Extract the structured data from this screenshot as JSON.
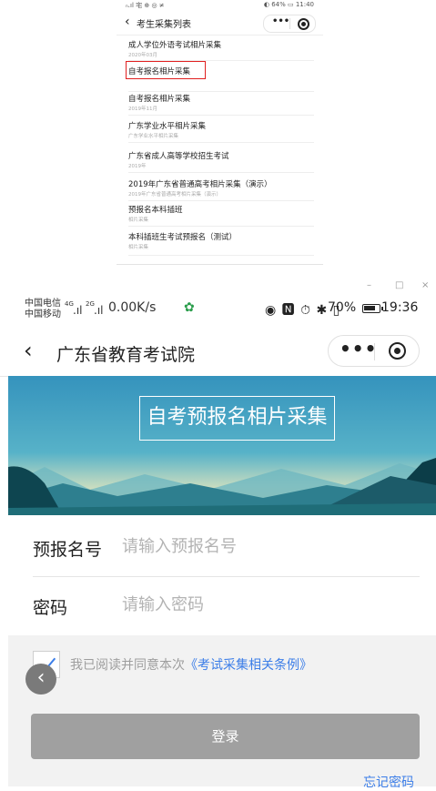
{
  "top_screenshot": {
    "status_left": "ₙ.ıl 宅 ⊕ ◎ ≭",
    "status_right": "◐ 64% ▭ 11:40",
    "title": "考生采集列表",
    "items": [
      {
        "title": "成人学位外语考试相片采集",
        "subtitle": "2020年03月"
      },
      {
        "title": "自考报名相片采集",
        "subtitle": ""
      },
      {
        "title": "自考报名相片采集",
        "subtitle": "2019年11月"
      },
      {
        "title": "广东学业水平相片采集",
        "subtitle": "广东学业水平相片采集"
      },
      {
        "title": "广东省成人高等学校招生考试",
        "subtitle": "2019年"
      },
      {
        "title": "2019年广东省普通高考相片采集（演示）",
        "subtitle": "2019年广东省普通高考相片采集（演示）"
      },
      {
        "title": "预报名本科插班",
        "subtitle": "相片采集"
      },
      {
        "title": "本科插班生考试预报名（测试）",
        "subtitle": "相片采集"
      }
    ]
  },
  "window_controls": {
    "minimize": "–",
    "maximize": "□",
    "close": "×"
  },
  "status_bar": {
    "carrier1": "中国电信",
    "carrier2": "中国移动",
    "net1": "4G",
    "net2": "2G",
    "speed": "0.00K/s",
    "sys_icons": "◉ 🅽 ⏱ ✱ ▯ ",
    "battery_pct": "70%",
    "time": "19:36",
    "battery_level": 0.7
  },
  "nav": {
    "back_icon": "chevron-left-icon",
    "title": "广东省教育考试院",
    "more_icon": "more-dots-icon",
    "close_icon": "target-icon"
  },
  "banner": {
    "title": "自考预报名相片采集"
  },
  "form": {
    "reg_label": "预报名号",
    "reg_placeholder": "请输入预报名号",
    "pwd_label": "密码",
    "pwd_placeholder": "请输入密码"
  },
  "agreement": {
    "text": "我已阅读并同意本次",
    "link": "《考试采集相关条例》",
    "checked": true
  },
  "login_button": "登录",
  "forgot_password": "忘记密码",
  "colors": {
    "link": "#3c7ee8",
    "button": "#a0a0a0",
    "banner_sky": "#3a9bc1",
    "highlight": "#e02020"
  }
}
